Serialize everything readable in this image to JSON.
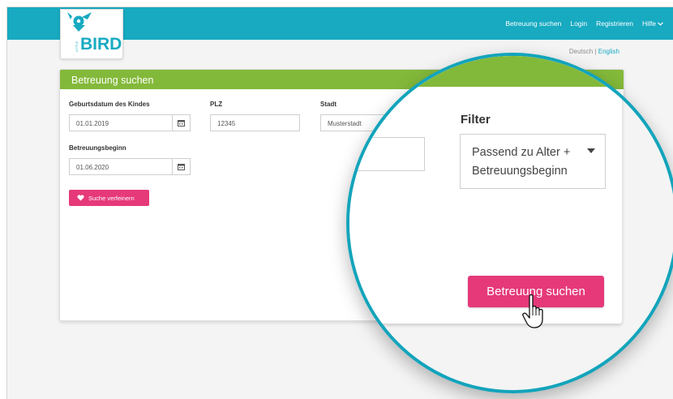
{
  "nav": {
    "items": [
      "Betreuung suchen",
      "Login",
      "Registrieren",
      "Hilfe"
    ]
  },
  "logo": {
    "text": "BIRD",
    "small_text": "LITTLE"
  },
  "language": {
    "deutsch": "Deutsch",
    "separator": "|",
    "english": "English"
  },
  "card": {
    "title": "Betreuung suchen",
    "birthdate_label": "Geburtsdatum des Kindes",
    "birthdate_value": "01.01.2019",
    "plz_label": "PLZ",
    "plz_value": "12345",
    "city_label": "Stadt",
    "city_value": "Musterstadt",
    "start_label": "Betreuungsbeginn",
    "start_value": "01.06.2020",
    "refine_label": "Suche verfeinern"
  },
  "zoom": {
    "filter_title": "Filter",
    "filter_line1": "Passend zu Alter +",
    "filter_line2": "Betreuungsbeginn",
    "search_button": "Betreuung suchen"
  },
  "colors": {
    "brand_teal": "#17aac1",
    "header_green": "#83b93a",
    "accent_pink": "#e6397a"
  }
}
